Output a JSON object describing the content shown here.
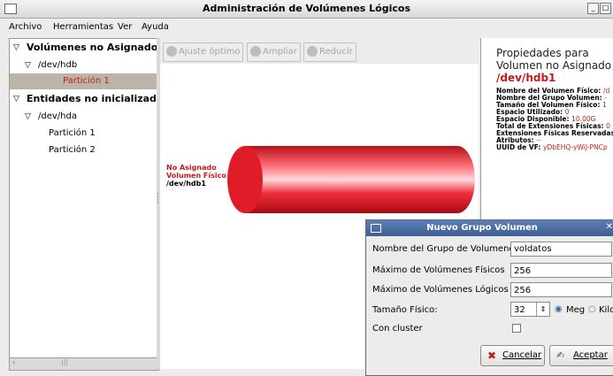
{
  "window": {
    "title": "Administración de Volúmenes Lógicos"
  },
  "menu": [
    "Archivo",
    "Herramientas",
    "Ver",
    "Ayuda"
  ],
  "tree": {
    "unassigned_header": "Volúmenes no Asignados",
    "hdb": "/dev/hdb",
    "hdb_part1": "Partición 1",
    "uninit_header": "Entidades no inicializada",
    "hda": "/dev/hda",
    "hda_part1": "Partición 1",
    "hda_part2": "Partición 2"
  },
  "toolbar": {
    "optimal": "Ajuste óptimo",
    "zoom_in": "Ampliar",
    "zoom_out": "Reducir"
  },
  "graph": {
    "label_line1": "No Asignado",
    "label_line2": "Volumen Físico",
    "label_line3": "/dev/hdb1",
    "cylinder_color": "#e8202e"
  },
  "properties": {
    "heading1": "Propiedades para",
    "heading2": "Volumen no Asignado",
    "device": "/dev/hdb1",
    "rows": [
      {
        "label": "Nombre del Volumen Físico:",
        "value": "/d"
      },
      {
        "label": "Nombre del Grupo Volumen:",
        "value": "-"
      },
      {
        "label": "Tamaño del Volumen Físico:",
        "value": "1"
      },
      {
        "label": "Espacio Utilizado:",
        "value": "0"
      },
      {
        "label": "Espacio Disponible:",
        "value": "10.00G"
      },
      {
        "label": "Total de Extensiones Físicas:",
        "value": "0"
      },
      {
        "label": "Extensiones Físicas Reservadas:",
        "value": ""
      },
      {
        "label": "Atributos:",
        "value": "--"
      },
      {
        "label": "UUID de VF:",
        "value": "yDbEHQ-yWiJ-PNCp"
      }
    ]
  },
  "dialog": {
    "title": "Nuevo Grupo Volumen",
    "vg_name_label": "Nombre del Grupo de Volumenes",
    "vg_name_value": "voldatos",
    "max_pv_label": "Máximo de Volúmenes Físicos",
    "max_pv_value": "256",
    "max_lv_label": "Máximo de Volúmenes Lógicos",
    "max_lv_value": "256",
    "pe_size_label": "Tamaño Físico:",
    "pe_size_value": "32",
    "unit_meg": "Meg",
    "unit_kilo": "Kilo",
    "cluster_label": "Con cluster",
    "cancel": "Cancelar",
    "accept": "Aceptar"
  }
}
